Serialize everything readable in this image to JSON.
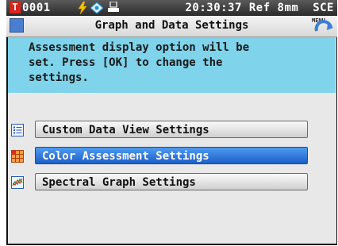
{
  "status_bar": {
    "badge": "T",
    "target_id": "0001",
    "time_info": "20:30:37 Ref 8mm  SCE",
    "icons": [
      "battery-bolt-icon",
      "sensor-icon",
      "device-icon"
    ]
  },
  "title_bar": {
    "title": "Graph and Data Settings",
    "menu_label": "MENU",
    "icons": [
      "screen-icon",
      "menu-return-icon"
    ]
  },
  "message": {
    "lines": [
      "Assessment display option will be",
      "set. Press [OK] to change the",
      "settings."
    ]
  },
  "menu": {
    "items": [
      {
        "label": "Custom Data View Settings",
        "icon": "list-icon",
        "selected": false
      },
      {
        "label": "Color Assessment Settings",
        "icon": "grid-icon",
        "selected": true
      },
      {
        "label": "Spectral Graph Settings",
        "icon": "graph-icon",
        "selected": false
      }
    ]
  },
  "colors": {
    "message_bg": "#7fd3ea",
    "selected_bg": "#2a74dd",
    "badge_red": "#d8241c"
  }
}
